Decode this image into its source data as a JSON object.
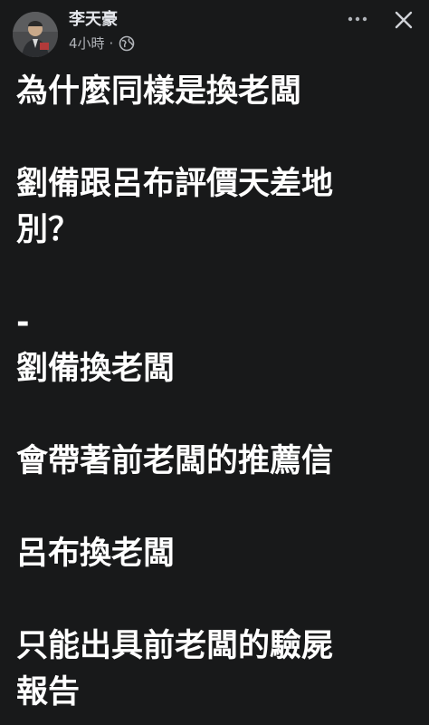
{
  "header": {
    "author": "李天豪",
    "time": "4小時",
    "separator": "·",
    "privacy_icon": "globe-icon",
    "more_icon": "more-dots-icon",
    "close_icon": "close-icon"
  },
  "post": {
    "lines": [
      "為什麼同樣是換老闆",
      "劉備跟呂布評價天差地",
      "別？",
      "-",
      "劉備換老闆",
      "會帶著前老闆的推薦信",
      "呂布換老闆",
      "只能出具前老闆的驗屍",
      "報告"
    ]
  },
  "colors": {
    "background": "#18191a",
    "text": "#ffffff",
    "secondary_text": "#b0b3b8"
  }
}
